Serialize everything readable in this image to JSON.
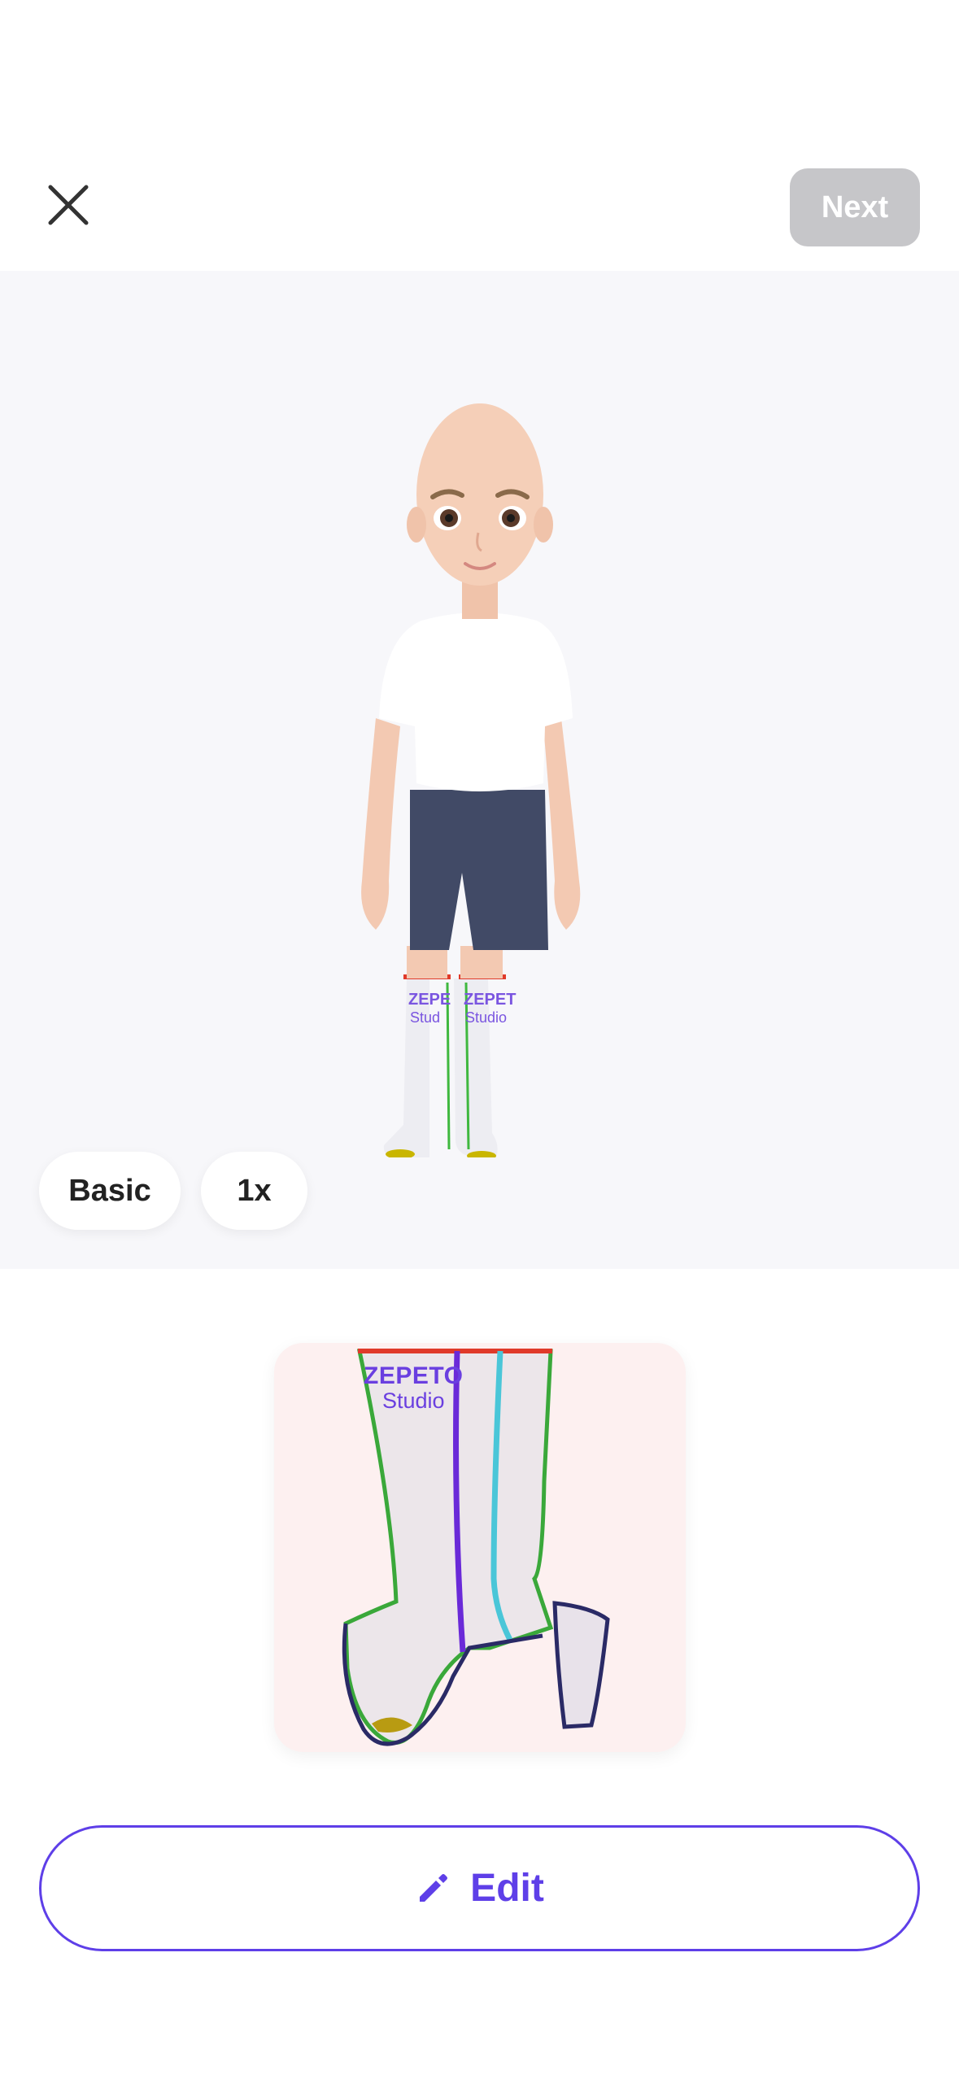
{
  "header": {
    "close_icon": "close-icon",
    "next_label": "Next"
  },
  "preview": {
    "mode_label": "Basic",
    "speed_label": "1x"
  },
  "texture": {
    "brand_line1": "ZEPETO",
    "brand_line2": "Studio"
  },
  "actions": {
    "edit_icon": "pencil-icon",
    "edit_label": "Edit"
  },
  "colors": {
    "accent": "#5e3fe8",
    "next_disabled": "#c6c6c9",
    "stage_bg": "#f7f7fa"
  }
}
